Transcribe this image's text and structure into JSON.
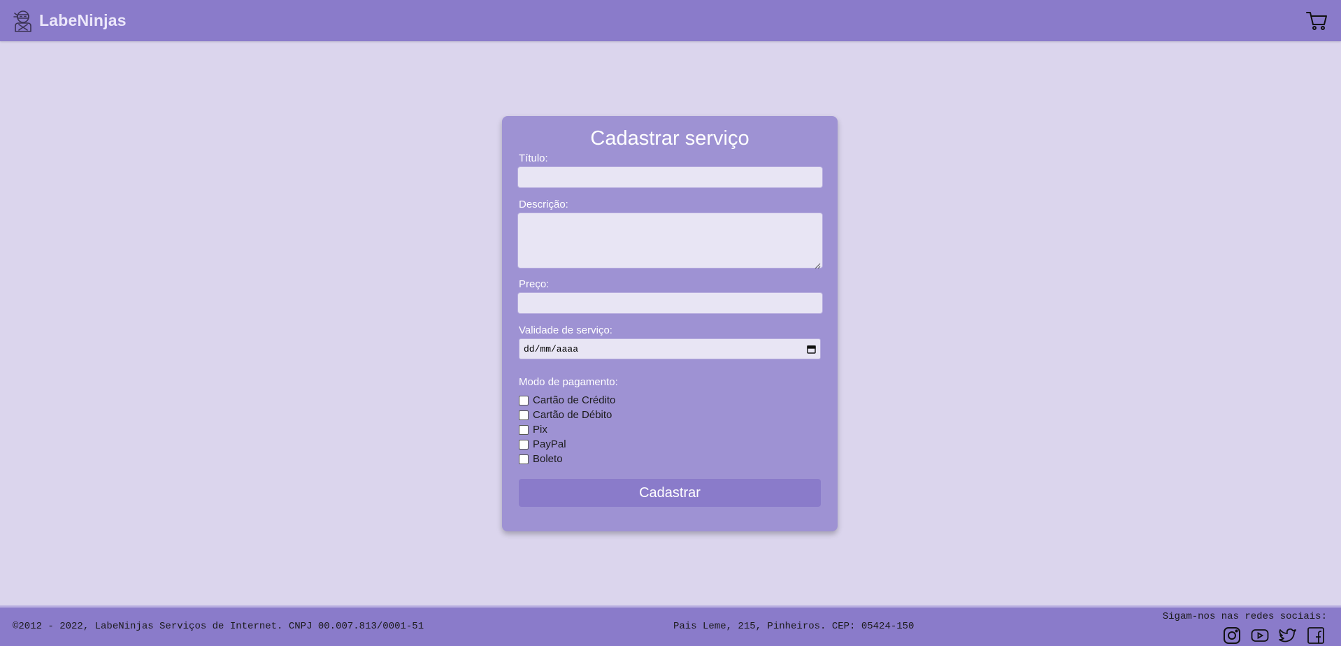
{
  "header": {
    "brand_name": "LabeNinjas",
    "logo_icon": "ninja-icon",
    "cart_icon": "cart-icon"
  },
  "form": {
    "title": "Cadastrar serviço",
    "titulo_label": "Título:",
    "titulo_value": "",
    "descricao_label": "Descrição:",
    "descricao_value": "",
    "preco_label": "Preço:",
    "preco_value": "",
    "validade_label": "Validade de serviço:",
    "validade_placeholder": "dd/mm/aaaa",
    "pagamento_label": "Modo de pagamento:",
    "payment_options": [
      {
        "label": "Cartão de Crédito",
        "checked": false
      },
      {
        "label": "Cartão de Débito",
        "checked": false
      },
      {
        "label": "Pix",
        "checked": false
      },
      {
        "label": "PayPal",
        "checked": false
      },
      {
        "label": "Boleto",
        "checked": false
      }
    ],
    "submit_label": "Cadastrar"
  },
  "footer": {
    "copyright": "©2012 - 2022, LabeNinjas Serviços de Internet. CNPJ 00.007.813/0001-51",
    "address": "Pais Leme, 215, Pinheiros. CEP: 05424-150",
    "social_title": "Sigam-nos nas redes sociais:",
    "social_icons": [
      "instagram-icon",
      "youtube-icon",
      "twitter-icon",
      "facebook-icon"
    ]
  },
  "colors": {
    "header_bg": "#8a7bca",
    "page_bg": "#dbd5ed",
    "card_bg": "#9e92d3",
    "input_bg": "#e8e5f4",
    "button_bg": "#8a7bca"
  }
}
